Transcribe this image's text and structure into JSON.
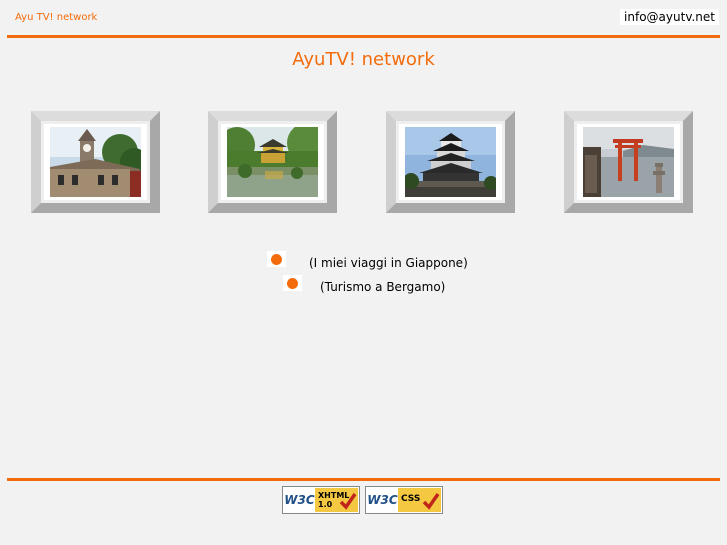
{
  "header": {
    "site_name": "Ayu TV! network",
    "email": "info@ayutv.net"
  },
  "main": {
    "title": "AyuTV! network",
    "photos": [
      {
        "icon": "clock-tower-photo"
      },
      {
        "icon": "golden-pavilion-photo"
      },
      {
        "icon": "castle-photo"
      },
      {
        "icon": "torii-gate-photo"
      }
    ],
    "links": [
      {
        "label": "(I miei viaggi in Giappone)"
      },
      {
        "label": "(Turismo a Bergamo)"
      }
    ]
  },
  "footer": {
    "badges": [
      {
        "logo": "W3C",
        "spec": "XHTML\n1.0"
      },
      {
        "logo": "W3C",
        "spec": "CSS"
      }
    ]
  },
  "colors": {
    "accent": "#f26c0d",
    "background": "#f2f2f2"
  }
}
